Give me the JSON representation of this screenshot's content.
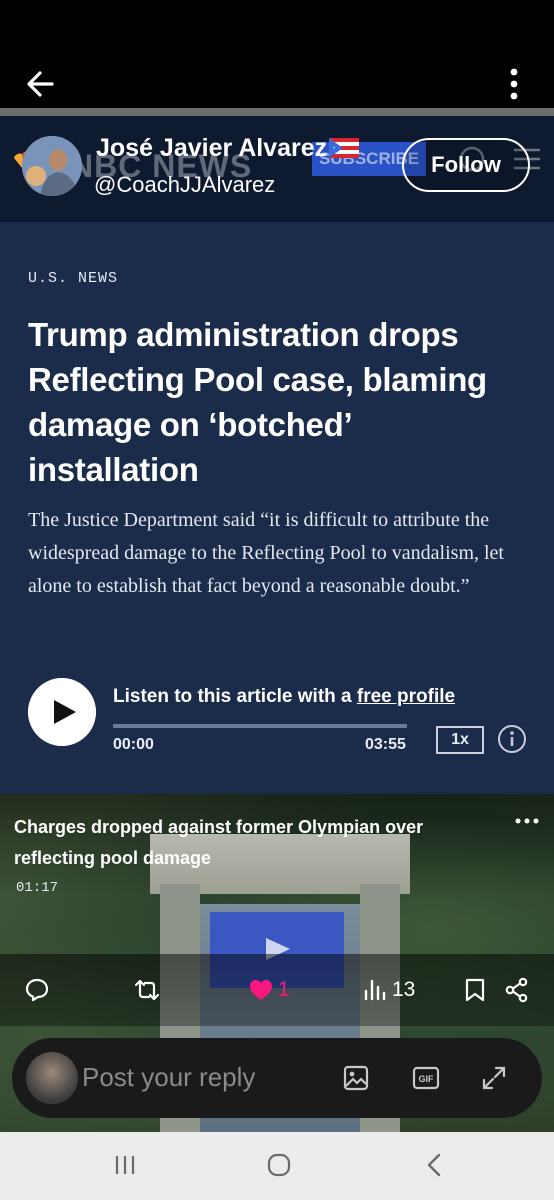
{
  "top_bar": {
    "back_icon": "arrow-left-icon",
    "more_icon": "more-vertical-icon"
  },
  "nbc_header": {
    "logo": "NBC NEWS",
    "subscribe": "SUBSCRIBE"
  },
  "author": {
    "name": "José Javier Alvarez",
    "handle": "@CoachJJAlvarez",
    "follow_label": "Follow"
  },
  "article": {
    "section": "U.S. NEWS",
    "headline": "Trump administration drops Reflecting Pool case, blaming damage on ‘botched’ installation",
    "dek": "The Justice Department said “it is difficult to attribute the widespread damage to the Reflecting Pool to vandalism, let alone to establish that fact beyond a reasonable doubt.”"
  },
  "audio": {
    "listen_prefix": "Listen to this article with a ",
    "listen_link": "free profile",
    "time_elapsed": "00:00",
    "time_total": "03:55",
    "speed": "1x",
    "progress": 0
  },
  "video": {
    "title": "Charges dropped against former Olympian over reflecting pool damage",
    "duration": "01:17"
  },
  "actions": {
    "replies": "",
    "retweets": "",
    "likes": "1",
    "views": "13"
  },
  "composer": {
    "placeholder": "Post your reply"
  },
  "colors": {
    "like": "#f91880",
    "subscribe": "#2952c7",
    "article_bg": "#1b2b4a"
  }
}
